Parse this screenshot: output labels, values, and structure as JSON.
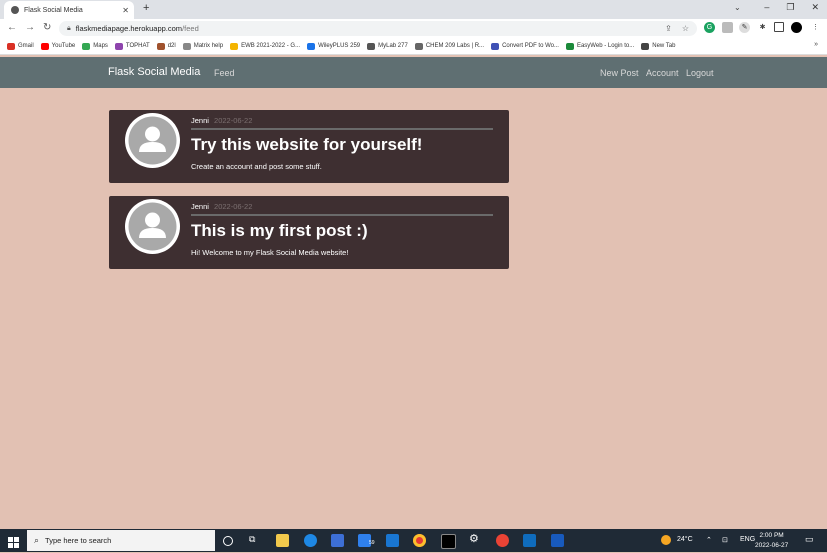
{
  "browser": {
    "tab_title": "Flask Social Media",
    "new_tab_glyph": "+",
    "url_host": "flaskmediapage.herokuapp.com",
    "url_path": "/feed",
    "bookmarks": [
      {
        "label": "Gmail",
        "color": "#d93025"
      },
      {
        "label": "YouTube",
        "color": "#ff0000"
      },
      {
        "label": "Maps",
        "color": "#34a853"
      },
      {
        "label": "TOPHAT",
        "color": "#8e44ad"
      },
      {
        "label": "d2l",
        "color": "#a0522d"
      },
      {
        "label": "Matrix help",
        "color": "#888888"
      },
      {
        "label": "EWB 2021-2022 - G...",
        "color": "#f4b400"
      },
      {
        "label": "WileyPLUS 259",
        "color": "#1a73e8"
      },
      {
        "label": "MyLab 277",
        "color": "#555555"
      },
      {
        "label": "CHEM 209 Labs | R...",
        "color": "#666666"
      },
      {
        "label": "Convert PDF to Wo...",
        "color": "#3f51b5"
      },
      {
        "label": "EasyWeb - Login to...",
        "color": "#1b8a3a"
      },
      {
        "label": "New Tab",
        "color": "#444444"
      }
    ]
  },
  "app": {
    "brand": "Flask Social Media",
    "nav_feed": "Feed",
    "nav_new_post": "New Post",
    "nav_account": "Account",
    "nav_logout": "Logout",
    "colors": {
      "navbar": "#5f6f72",
      "page_bg": "#e2c1b3",
      "card_bg": "#3e2f31"
    }
  },
  "posts": [
    {
      "author": "Jenni",
      "date": "2022-06-22",
      "title": "Try this website for yourself!",
      "content": "Create an account and post some stuff."
    },
    {
      "author": "Jenni",
      "date": "2022-06-22",
      "title": "This is my first post :)",
      "content": "Hi! Welcome to my Flask Social Media website!"
    }
  ],
  "taskbar": {
    "search_placeholder": "Type here to search",
    "badge_count": "59",
    "temperature": "24°C",
    "language": "ENG",
    "time": "2:00 PM",
    "date": "2022-06-27"
  }
}
